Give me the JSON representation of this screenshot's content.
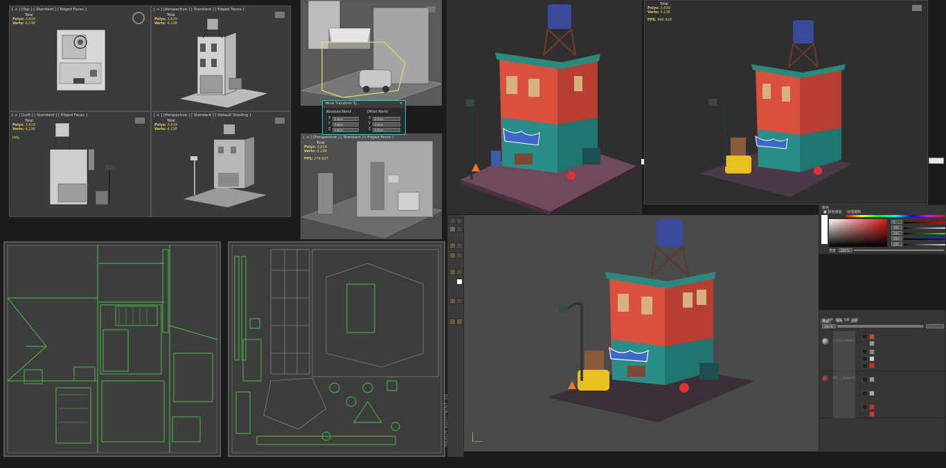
{
  "viewports": {
    "top": {
      "label": "[ + ] [Top ] [ Standard ] [ Edged Faces ]",
      "stats": {
        "total": "Total",
        "polys_label": "Polys:",
        "polys": "3,619",
        "verts_label": "Verts:",
        "verts": "4,138"
      }
    },
    "persp1": {
      "label": "[ + ] [Perspective ] [ Standard ] [ Edged Faces ]",
      "stats": {
        "total": "Total",
        "polys_label": "Polys:",
        "polys": "3,619",
        "verts_label": "Verts:",
        "verts": "4,138"
      }
    },
    "left": {
      "label": "[ + ] [Left ] [ Standard ] [ Edged Faces ]",
      "stats": {
        "total": "Total",
        "polys_label": "Polys:",
        "polys": "3,619",
        "verts_label": "Verts:",
        "verts": "4,138",
        "fps_label": "FPS:"
      }
    },
    "persp2": {
      "label": "[ + ] [Perspective ] [ Standard ] [ Default Shading ]",
      "stats": {
        "total": "Total",
        "polys_label": "Polys:",
        "polys": "3,619",
        "verts_label": "Verts:",
        "verts": "4,138"
      }
    },
    "persp3": {
      "label": "[ + ] [Perspective ] [ Standard ] [ Edged Faces ]",
      "stats": {
        "total": "Total",
        "polys_label": "Polys:",
        "polys": "3,619",
        "verts_label": "Verts:",
        "verts": "4,138",
        "fps_label": "FPS:",
        "fps": "274.597"
      }
    },
    "render2": {
      "stats": {
        "total": "Total",
        "polys_label": "Polys:",
        "polys": "3,619",
        "verts_label": "Verts:",
        "verts": "4,138",
        "fps_label": "FPS:",
        "fps": "490.918"
      }
    }
  },
  "transform_dialog": {
    "title": "Move Transform Ty...",
    "absolute_label": "Absolute:World",
    "offset_label": "Offset:World",
    "axes": [
      "X",
      "Y",
      "Z"
    ],
    "abs_values": [
      "0.0cm",
      "0.0cm",
      "0.0cm"
    ],
    "off_values": [
      "0.0cm",
      "0.0cm",
      "0.0cm"
    ]
  },
  "color_panel": {
    "title": "颜色",
    "tab1": "■ 颜色通道",
    "tab2": "纹理编辑",
    "values": [
      "0",
      "100",
      "200",
      "200",
      "200"
    ],
    "footer_label": "亮度",
    "footer_value": "100 %"
  },
  "layers_panel": {
    "tabs": [
      "图层",
      "属性",
      "通道"
    ],
    "menu": [
      "层",
      "文件",
      "编辑",
      "功能",
      "纹理"
    ],
    "blend_value": "100 %",
    "layer_items": [
      "0_Color(Base)",
      "01_..._Color(1)"
    ]
  },
  "brand_text": "MAXON BODYPAINT 3D",
  "colors": {
    "wire_green": "#4ec44e",
    "accent_cyan": "#2ec8d2",
    "stat_yellow": "#e8d36a",
    "render_bg": "#2f2f30"
  }
}
